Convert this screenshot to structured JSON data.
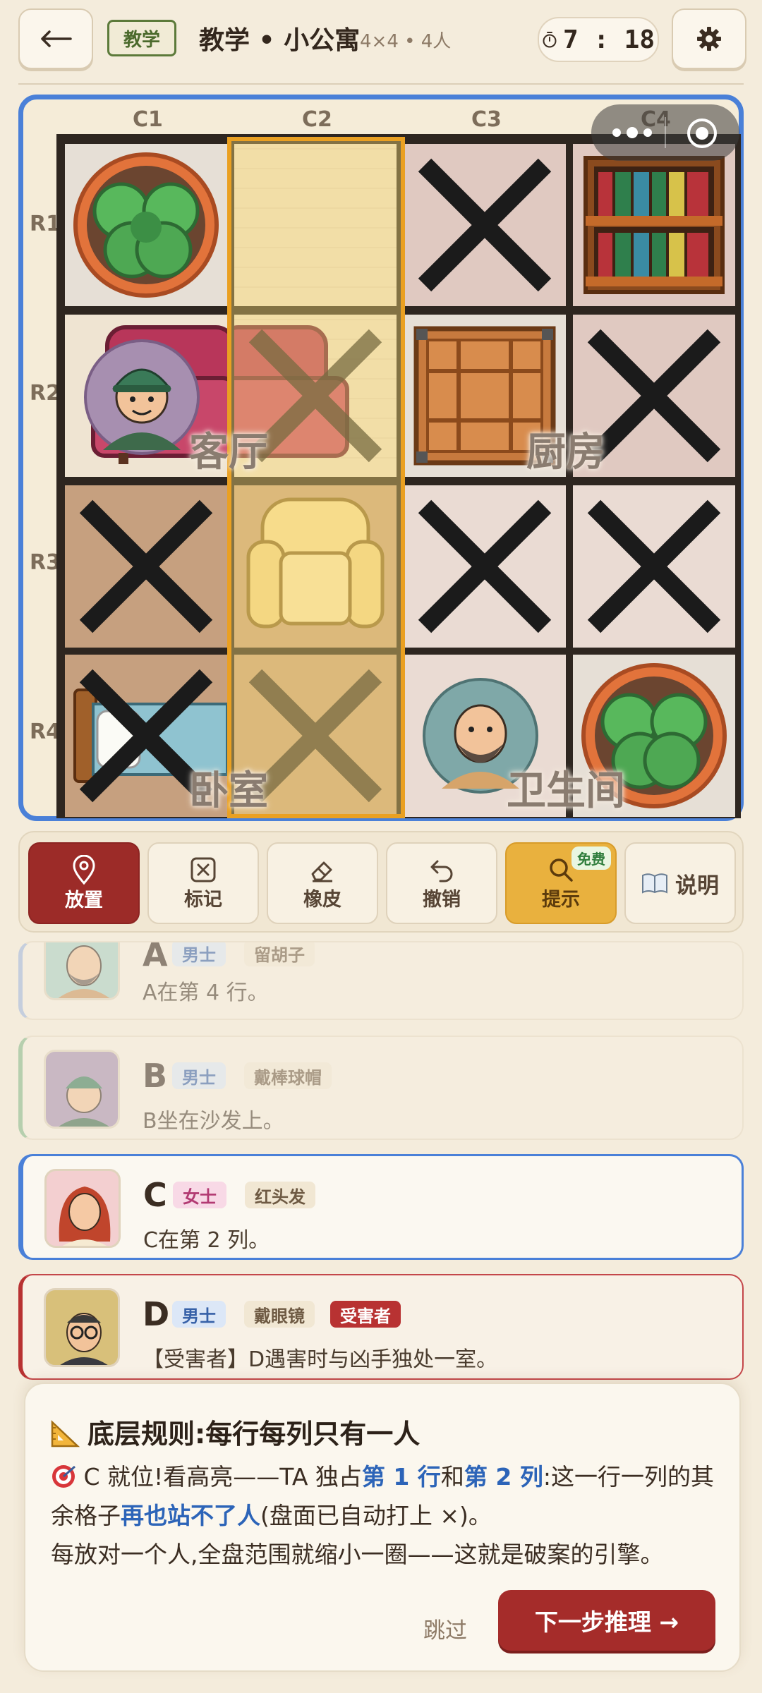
{
  "header": {
    "mode_tag": "教学",
    "title": "教学 • 小公寓",
    "subtitle": "4×4 • 4人",
    "timer": "7 : 18"
  },
  "board": {
    "columns": [
      "C1",
      "C2",
      "C3",
      "C4"
    ],
    "rows": [
      "R1",
      "R2",
      "R3",
      "R4"
    ],
    "rooms": [
      "客厅",
      "厨房",
      "卧室",
      "卫生间"
    ],
    "highlighted_column": "C2",
    "cells": [
      {
        "pos": "R1C1",
        "item": "potted-plant",
        "mark": ""
      },
      {
        "pos": "R1C2",
        "item": "",
        "mark": ""
      },
      {
        "pos": "R1C3",
        "item": "",
        "mark": "x"
      },
      {
        "pos": "R1C4",
        "item": "bookshelf",
        "mark": ""
      },
      {
        "pos": "R2C1",
        "item": "sofa",
        "mark": "",
        "person": "B"
      },
      {
        "pos": "R2C2",
        "item": "sofa",
        "mark": "x"
      },
      {
        "pos": "R2C3",
        "item": "crate",
        "mark": ""
      },
      {
        "pos": "R2C4",
        "item": "",
        "mark": "x"
      },
      {
        "pos": "R3C1",
        "item": "",
        "mark": "x"
      },
      {
        "pos": "R3C2",
        "item": "armchair",
        "mark": ""
      },
      {
        "pos": "R3C3",
        "item": "",
        "mark": "x"
      },
      {
        "pos": "R3C4",
        "item": "",
        "mark": "x"
      },
      {
        "pos": "R4C1",
        "item": "bed",
        "mark": "x"
      },
      {
        "pos": "R4C2",
        "item": "",
        "mark": "x"
      },
      {
        "pos": "R4C3",
        "item": "",
        "mark": "",
        "person": "A"
      },
      {
        "pos": "R4C4",
        "item": "potted-plant",
        "mark": ""
      }
    ]
  },
  "toolbar": {
    "place": "放置",
    "mark": "标记",
    "eraser": "橡皮",
    "undo": "撤销",
    "hint": "提示",
    "hint_badge": "免费",
    "help": "说明"
  },
  "clues": [
    {
      "letter": "A",
      "gender": "男士",
      "trait": "留胡子",
      "text": "A在第 4 行。"
    },
    {
      "letter": "B",
      "gender": "男士",
      "trait": "戴棒球帽",
      "text": "B坐在沙发上。"
    },
    {
      "letter": "C",
      "gender": "女士",
      "trait": "红头发",
      "text": "C在第 2 列。"
    },
    {
      "letter": "D",
      "gender": "男士",
      "trait": "戴眼镜",
      "role": "受害者",
      "text": "【受害者】D遇害时与凶手独处一室。"
    }
  ],
  "tutorial": {
    "title": "底层规则:每行每列只有一人",
    "p1_a": "C 就位!看高亮——TA 独占",
    "p1_b": "第 1 行",
    "p1_c": "和",
    "p1_d": "第 2 列",
    "p1_e": ":这一行一列的其余格子",
    "p1_f": "再也站不了人",
    "p1_g": "(盘面已自动打上 ×)。",
    "p2": "每放对一个人,全盘范围就缩小一圈——这就是破案的引擎。",
    "skip": "跳过",
    "next": "下一步推理 →"
  },
  "colors": {
    "board_border": "#4a80d8",
    "highlight": "#eaa021",
    "primary": "#9c2b28",
    "hint": "#e9b13e"
  }
}
